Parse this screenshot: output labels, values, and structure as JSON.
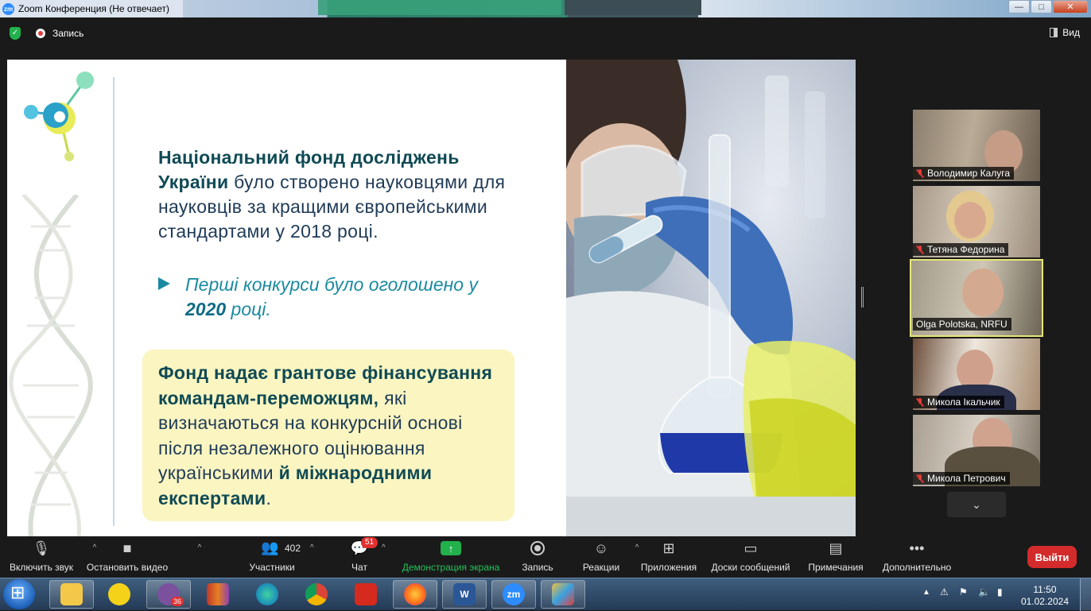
{
  "window": {
    "title": "Zoom Конференция (Не отвечает)",
    "app_icon": "zm",
    "buttons": {
      "minimize": "—",
      "maximize": "□",
      "close": "✕"
    }
  },
  "meeting_header": {
    "recording_label": "Запись",
    "view_label": "Вид"
  },
  "slide": {
    "main_bold": "Національний фонд досліджень України",
    "main_rest": " було створено науковцями для науковців за кращими європейськими стандартами у 2018 році.",
    "bullet_pre": "Перші конкурси було оголошено у ",
    "bullet_year": "2020",
    "bullet_post": " році.",
    "box_bold1": "Фонд надає грантове фінансування командам-переможцям,",
    "box_text1": " які визначаються на конкурсній основі після незалежного оцінювання українськими ",
    "box_bold2": "й міжнародними експертами",
    "box_end": ".",
    "accent_colors": {
      "teal": "#1a8aa0",
      "dark": "#1f3b57",
      "box": "#fbf5c1"
    }
  },
  "participants": [
    {
      "name": "Володимир Калуга",
      "muted": true,
      "active": false
    },
    {
      "name": "Тетяна Федорина",
      "muted": true,
      "active": false
    },
    {
      "name": "Olga Polotska, NRFU",
      "muted": false,
      "active": true
    },
    {
      "name": "Микола Ікальчик",
      "muted": true,
      "active": false
    },
    {
      "name": "Микола Петрович",
      "muted": true,
      "active": false
    }
  ],
  "toolbar": {
    "mute_label": "Включить звук",
    "video_label": "Остановить видео",
    "participants_label": "Участники",
    "participants_count": "402",
    "chat_label": "Чат",
    "chat_badge": "51",
    "share_label": "Демонстрация экрана",
    "record_label": "Запись",
    "reactions_label": "Реакции",
    "apps_label": "Приложения",
    "whiteboards_label": "Доски сообщений",
    "notes_label": "Примечания",
    "more_label": "Дополнительно",
    "leave_label": "Выйти"
  },
  "taskbar": {
    "viber_badge": "36",
    "word_label": "W",
    "zoom_label": "zm",
    "time": "11:50",
    "date": "01.02.2024"
  }
}
